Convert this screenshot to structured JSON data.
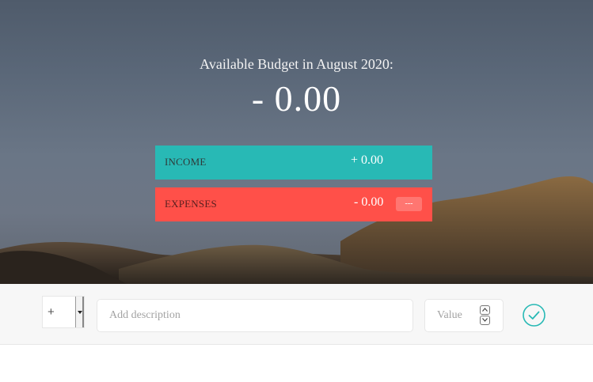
{
  "budget": {
    "title": "Available Budget in August 2020:",
    "value": "- 0.00"
  },
  "income": {
    "label": "INCOME",
    "value": "+ 0.00",
    "color": "#28b9b5"
  },
  "expenses": {
    "label": "EXPENSES",
    "value": "- 0.00",
    "percentage": "---",
    "color": "#ff5049"
  },
  "add": {
    "type_selected": "+",
    "description_placeholder": "Add description",
    "value_placeholder": "Value",
    "submit_icon": "checkmark-circle-icon"
  }
}
